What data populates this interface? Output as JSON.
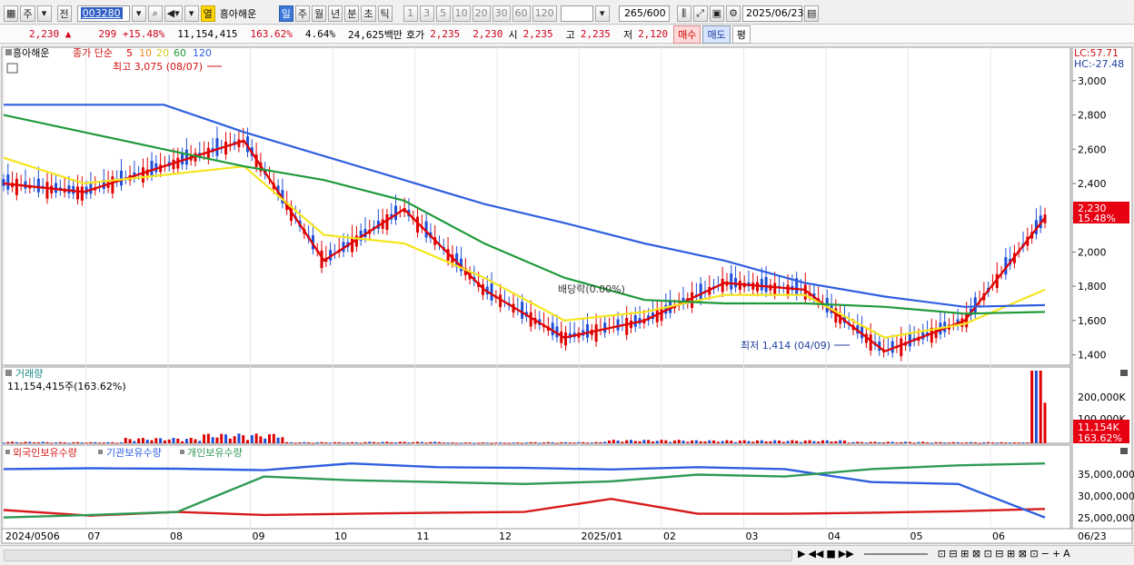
{
  "toolbar": {
    "market_type": "주",
    "prefix": "전",
    "code": "003280",
    "stock_name": "흥아해운",
    "name_flag": "열",
    "periods": [
      "일",
      "주",
      "월",
      "년",
      "분",
      "초",
      "틱"
    ],
    "active_period": "일",
    "intervals": [
      "1",
      "3",
      "5",
      "10",
      "20",
      "30",
      "60",
      "120"
    ],
    "count": "265",
    "count_max": "/600",
    "date": "2025/06/23"
  },
  "quote": {
    "price": "2,230",
    "change": "299",
    "change_pct": "+15.48%",
    "volume": "11,154,415",
    "volume_ratio": "163.62%",
    "turnover": "4.64%",
    "amount": "24,625백만",
    "ask_label": "호가",
    "ask": "2,235",
    "bid": "2,230",
    "open_label": "시",
    "open": "2,235",
    "high_label": "고",
    "high": "2,235",
    "low_label": "저",
    "low": "2,120",
    "buy_btn": "매수",
    "sell_btn": "매도",
    "eval_btn": "평"
  },
  "price_panel": {
    "stock_tag": "흥아해운",
    "ma_title": "종가 단순",
    "ma_periods": [
      "5",
      "10",
      "20",
      "60",
      "120"
    ],
    "ma_colors": [
      "#e00000",
      "#f08a1c",
      "#f5e51d",
      "#1f9a3a",
      "#2f5fe0"
    ],
    "high_label": "최고 3,075 (08/07)",
    "low_label": "최저 1,414 (04/09)",
    "dividend_label": "배당락(0.00%)",
    "lc": "LC:57.71",
    "hc": "HC:-27.48",
    "y_ticks": [
      "3,000",
      "2,800",
      "2,600",
      "2,400",
      "2,200",
      "2,000",
      "1,800",
      "1,600",
      "1,400"
    ],
    "current_price_tag": "2,230",
    "current_pct_tag": "15.48%"
  },
  "volume_panel": {
    "title": "거래량",
    "value": "11,154,415주(163.62%)",
    "y_ticks": [
      "200,000K",
      "100,000K"
    ],
    "current_tag": "11,154K",
    "current_pct": "163.62%"
  },
  "holdings_panel": {
    "legend": [
      "외국인보유수량",
      "기관보유수량",
      "개인보유수량"
    ],
    "colors": [
      "#d81b1b",
      "#2f5fe0",
      "#2e9a55"
    ],
    "y_ticks": [
      "35,000,000",
      "30,000,000",
      "25,000,000"
    ]
  },
  "x_axis": {
    "labels": [
      "2024/0506",
      "07",
      "08",
      "09",
      "10",
      "11",
      "12",
      "2025/01",
      "02",
      "03",
      "04",
      "05",
      "06"
    ],
    "right_label": "06/23"
  },
  "chart_data": [
    {
      "type": "line",
      "title": "흥아해운 종가 단순",
      "x": [
        "2024/05",
        "06",
        "07",
        "08",
        "09",
        "10",
        "11",
        "12",
        "2025/01",
        "02",
        "03",
        "04",
        "05",
        "06"
      ],
      "series": [
        {
          "name": "5",
          "values": [
            2400,
            2350,
            2500,
            2650,
            1950,
            2250,
            1780,
            1500,
            1600,
            1820,
            1780,
            1420,
            1600,
            2200
          ]
        },
        {
          "name": "20",
          "values": [
            2550,
            2400,
            2450,
            2500,
            2100,
            2050,
            1850,
            1600,
            1650,
            1750,
            1750,
            1500,
            1580,
            1780
          ]
        },
        {
          "name": "60",
          "values": [
            2800,
            2700,
            2600,
            2500,
            2420,
            2300,
            2050,
            1850,
            1720,
            1700,
            1700,
            1680,
            1640,
            1650
          ]
        },
        {
          "name": "120",
          "values": [
            2860,
            2860,
            2860,
            2700,
            2560,
            2420,
            2280,
            2170,
            2050,
            1950,
            1820,
            1740,
            1680,
            1690
          ]
        }
      ],
      "ylim": [
        1400,
        3075
      ]
    },
    {
      "type": "bar",
      "title": "거래량",
      "x": [
        "2024/05",
        "06",
        "07",
        "08",
        "09",
        "10",
        "11",
        "12",
        "2025/01",
        "02",
        "03",
        "04",
        "05",
        "06"
      ],
      "values": [
        4000,
        3000,
        14000,
        25000,
        3000,
        4000,
        2000,
        3000,
        9000,
        8000,
        8000,
        4000,
        3000,
        270000
      ],
      "unit": "K"
    },
    {
      "type": "line",
      "title": "보유수량",
      "x": [
        "2024/05",
        "07",
        "08",
        "09",
        "10",
        "11",
        "12",
        "2025/01",
        "02",
        "03",
        "04",
        "05",
        "06"
      ],
      "series": [
        {
          "name": "외국인보유수량",
          "values": [
            25500,
            24000,
            25000,
            24200,
            24500,
            24800,
            25000,
            28500,
            24500,
            24500,
            24800,
            25200,
            25800
          ]
        },
        {
          "name": "기관보유수량",
          "values": [
            36500,
            36700,
            36600,
            36200,
            38000,
            37000,
            36800,
            36400,
            37000,
            36500,
            33000,
            32500,
            23500
          ]
        },
        {
          "name": "개인보유수량",
          "values": [
            23500,
            24200,
            25000,
            34500,
            33500,
            33000,
            32500,
            33200,
            35000,
            34500,
            36500,
            37500,
            38000
          ]
        }
      ]
    }
  ]
}
